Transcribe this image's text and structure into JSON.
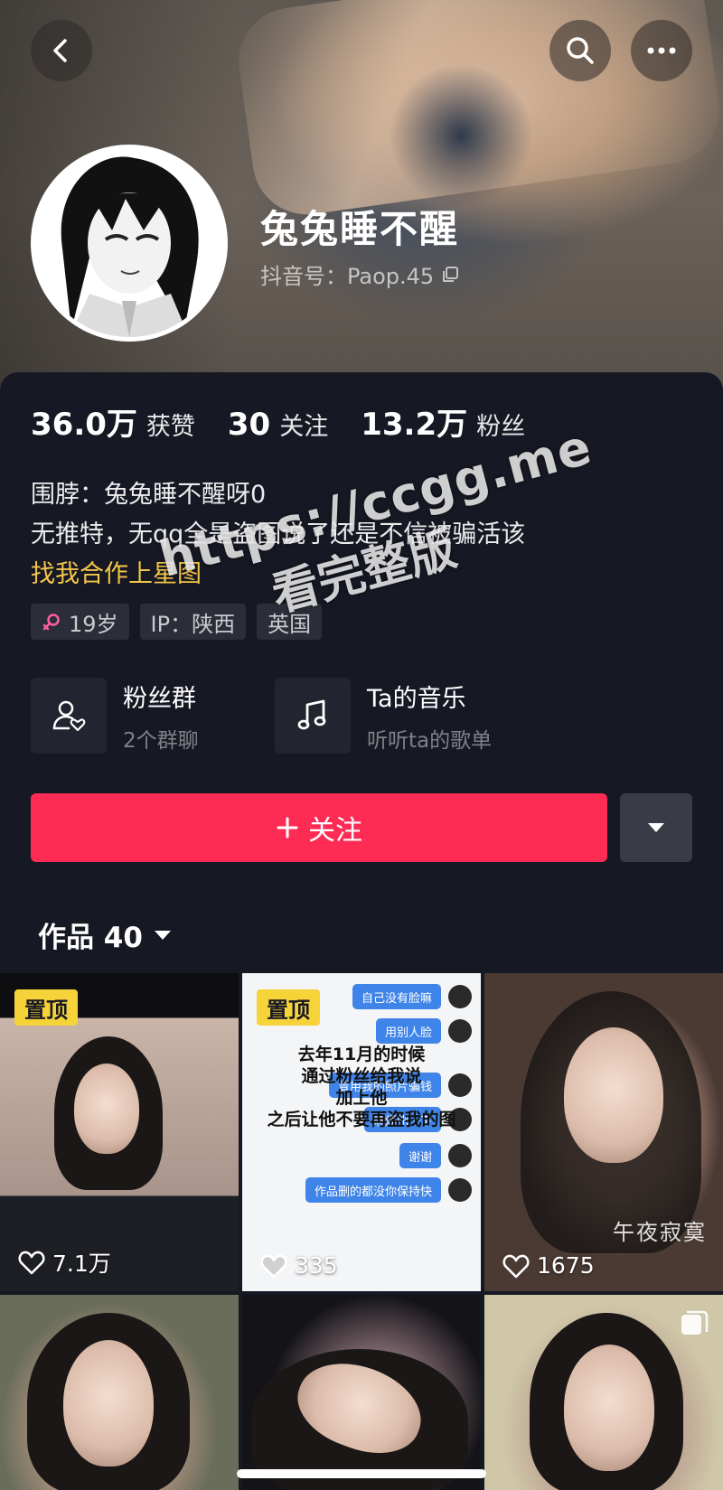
{
  "profile": {
    "nickname": "兔兔睡不醒",
    "douyin_id": "抖音号：Paop.45"
  },
  "stats": [
    {
      "value": "36.0万",
      "label": "获赞"
    },
    {
      "value": "30",
      "label": "关注"
    },
    {
      "value": "13.2万",
      "label": "粉丝"
    }
  ],
  "bio": {
    "line1": "围脖：兔兔睡不醒呀0",
    "line2": "无推特，无qq全是盗图说了还是不信被骗活该",
    "link": "找我合作上星图"
  },
  "tags": {
    "age": "19岁",
    "ip": "IP：陕西",
    "school": "英国"
  },
  "features": [
    {
      "title": "粉丝群",
      "subtitle": "2个群聊",
      "icon": "fan-group-icon"
    },
    {
      "title": "Ta的音乐",
      "subtitle": "听听ta的歌单",
      "icon": "music-note-icon"
    }
  ],
  "actions": {
    "follow": "关注"
  },
  "works_tab": {
    "label": "作品 40"
  },
  "videos": [
    {
      "pinned": "置顶",
      "likes": "7.1万"
    },
    {
      "pinned": "置顶",
      "likes": "335",
      "overlay_text": [
        "去年11月的时候",
        "通过粉丝给我说",
        "加上他",
        "之后让他不要再盗我的图"
      ],
      "bubbles": [
        "自己没有脸嘛",
        "用别人脸",
        "冒用我的照片骗钱",
        "麻烦删一下",
        "谢谢",
        "作品删的都没你保持快"
      ]
    },
    {
      "likes": "1675",
      "caption": "午夜寂寞"
    },
    {},
    {},
    {}
  ],
  "watermark": {
    "line1": "https://ccgg.me",
    "line2": "看完整版"
  },
  "colors": {
    "background": "#161823",
    "accent": "#fe2c55",
    "link": "#f4c649",
    "pin_badge": "#f7d33a"
  }
}
